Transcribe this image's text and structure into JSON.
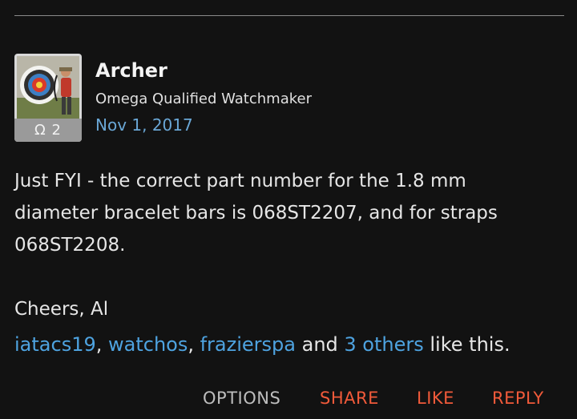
{
  "post": {
    "author": {
      "name": "Archer",
      "title": "Omega Qualified Watchmaker",
      "rank_badge": "Ω 2"
    },
    "date": "Nov 1, 2017",
    "body": {
      "paragraph1": "Just FYI - the correct part number for the 1.8 mm diameter bracelet bars is 068ST2207, and for straps 068ST2208.",
      "paragraph2": "Cheers, Al"
    },
    "likes": {
      "user1": "iatacs19",
      "sep1": ", ",
      "user2": "watchos",
      "sep2": ", ",
      "user3": "frazierspa",
      "and_text": " and ",
      "others": "3 others",
      "suffix": " like this."
    },
    "actions": {
      "options": "OPTIONS",
      "share": "SHARE",
      "like": "LIKE",
      "reply": "REPLY"
    }
  },
  "colors": {
    "background": "#121212",
    "link": "#4ea3e0",
    "date": "#6aa7d6",
    "action_accent": "#f15a3a",
    "action_muted": "#bdbdbd"
  }
}
